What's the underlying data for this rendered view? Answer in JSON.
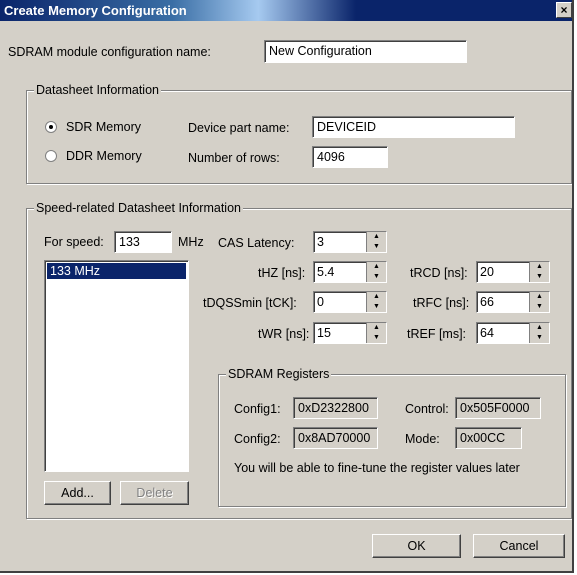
{
  "window": {
    "title": "Create Memory Configuration",
    "close_glyph": "×"
  },
  "config_name": {
    "label": "SDRAM module configuration name:",
    "value": "New Configuration"
  },
  "datasheet": {
    "legend": "Datasheet Information",
    "sdr_label": "SDR Memory",
    "ddr_label": "DDR Memory",
    "selected": "SDR Memory",
    "device_label": "Device part name:",
    "device_value": "DEVICEID",
    "rows_label": "Number of rows:",
    "rows_value": "4096"
  },
  "speed": {
    "legend": "Speed-related Datasheet Information",
    "for_speed_label": "For speed:",
    "for_speed_value": "133",
    "mhz_label": "MHz",
    "list_items": [
      "133 MHz"
    ],
    "add_label": "Add...",
    "delete_label": "Delete",
    "cas": {
      "label": "CAS Latency:",
      "value": "3"
    },
    "thz": {
      "label": "tHZ [ns]:",
      "value": "5.4"
    },
    "trcd": {
      "label": "tRCD [ns]:",
      "value": "20"
    },
    "tdqs": {
      "label": "tDQSSmin [tCK]:",
      "value": "0"
    },
    "trfc": {
      "label": "tRFC [ns]:",
      "value": "66"
    },
    "twr": {
      "label": "tWR [ns]:",
      "value": "15"
    },
    "tref": {
      "label": "tREF [ms]:",
      "value": "64"
    }
  },
  "registers": {
    "legend": "SDRAM Registers",
    "config1_label": "Config1:",
    "config1_value": "0xD2322800",
    "control_label": "Control:",
    "control_value": "0x505F0000",
    "config2_label": "Config2:",
    "config2_value": "0x8AD70000",
    "mode_label": "Mode:",
    "mode_value": "0x00CC",
    "note": "You will be able to fine-tune the register values later"
  },
  "buttons": {
    "ok": "OK",
    "cancel": "Cancel"
  },
  "colors": {
    "title_bar": "#0a246a",
    "dialog_bg": "#d4d0c8",
    "selection": "#0a246a"
  },
  "icons": {
    "spin_up": "▲",
    "spin_down": "▼"
  }
}
